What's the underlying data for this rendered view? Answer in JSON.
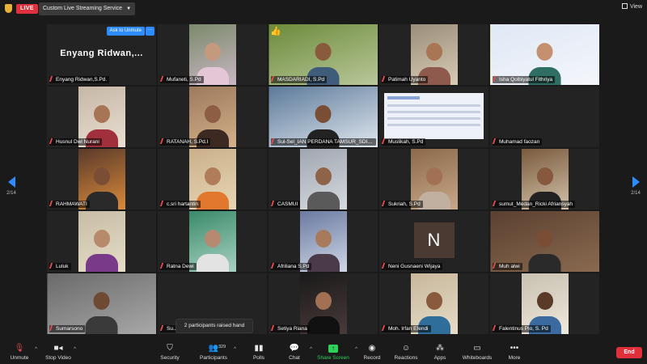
{
  "topbar": {
    "live_label": "LIVE",
    "stream_label": "Custom Live Streaming Service",
    "view_label": "View"
  },
  "pagination": {
    "left": "2/14",
    "right": "2/14"
  },
  "participants": [
    {
      "name": "Enyang Ridwan,S.Pd.",
      "display_text": "Enyang  Ridwan,...",
      "kind": "text",
      "unmute_label": "Ask to Unmute",
      "more_label": "···"
    },
    {
      "name": "Mufaneti, S.Pd",
      "kind": "video",
      "c1": "#7a8a6a",
      "c2": "#c9b6c4",
      "skin": "#c59a7c",
      "shirt": "#e3c7d6"
    },
    {
      "name": "MASDARIADI, S.Pd",
      "kind": "video",
      "wide": true,
      "c1": "#6c8a3a",
      "c2": "#b9c89a",
      "skin": "#8a5a3c",
      "shirt": "#3f5d7a",
      "hand": "👍"
    },
    {
      "name": "Patimah Uyanto",
      "kind": "video",
      "c1": "#9a8e7a",
      "c2": "#d8ccb6",
      "skin": "#a87654",
      "shirt": "#8e5a4e"
    },
    {
      "name": "Isha Qolbiyatul Fithriya",
      "kind": "video",
      "wide": true,
      "active": true,
      "c1": "#dfe8f5",
      "c2": "#f4f6fb",
      "skin": "#c49070",
      "shirt": "#2f6e62"
    },
    {
      "name": "Husnul Dwi Nurani",
      "kind": "video",
      "c1": "#c6b7a6",
      "c2": "#e9dfd2",
      "skin": "#a77456",
      "shirt": "#a0303c"
    },
    {
      "name": "RATANAH, S.Pd.I",
      "kind": "video",
      "c1": "#9c7a5c",
      "c2": "#d4b08a",
      "skin": "#8e5e44",
      "shirt": "#3c2a22"
    },
    {
      "name": "Sul-Sel_IAN PERDANA TAMSUR_SDI Ma...",
      "kind": "video",
      "wide": true,
      "c1": "#5c7a9a",
      "c2": "#dfe6ee",
      "skin": "#7a4e34",
      "shirt": "#222"
    },
    {
      "name": "Muslikah, S.Pd",
      "kind": "slide",
      "c1": "#eef2f8",
      "c2": "#eef2f8"
    },
    {
      "name": "Muhamad faozan",
      "kind": "empty"
    },
    {
      "name": "RAHMAWATI",
      "kind": "video",
      "c1": "#5a3a2a",
      "c2": "#d98a3a",
      "skin": "#7a4e34",
      "shirt": "#2a2a2a"
    },
    {
      "name": "c.sri hartantin",
      "kind": "video",
      "c1": "#c9b08a",
      "c2": "#e8d6b4",
      "skin": "#b07c5a",
      "shirt": "#e2772e"
    },
    {
      "name": "CASMUI",
      "kind": "video",
      "c1": "#a0a6b0",
      "c2": "#d6dae0",
      "skin": "#8e6448",
      "shirt": "#5a5a5a"
    },
    {
      "name": "Sukriah, S.Pd",
      "kind": "video",
      "c1": "#8a6a4a",
      "c2": "#c8a888",
      "skin": "#a27052",
      "shirt": "#c1b0a0"
    },
    {
      "name": "sumut_Medan_Ricki Afriansyah",
      "kind": "video",
      "c1": "#7a5a3e",
      "c2": "#d2c2a8",
      "skin": "#86583e",
      "shirt": "#222"
    },
    {
      "name": "Luluk",
      "kind": "video",
      "c1": "#c7bda6",
      "c2": "#e6ddc6",
      "skin": "#b68a6a",
      "shirt": "#7a3a8a"
    },
    {
      "name": "Ratna Dewi",
      "kind": "video",
      "c1": "#3a8a6a",
      "c2": "#a8d2c2",
      "skin": "#b58a70",
      "shirt": "#e3e3e3"
    },
    {
      "name": "Afriliana S.Pd",
      "kind": "video",
      "c1": "#6a7aa0",
      "c2": "#cfd6e6",
      "skin": "#a87a5c",
      "shirt": "#4a3a4a"
    },
    {
      "name": "Neni Gusnaeni Wijaya",
      "kind": "initial",
      "initial": "N"
    },
    {
      "name": "Muh alwi",
      "kind": "video",
      "wide": true,
      "c1": "#5a4030",
      "c2": "#8a6a50",
      "skin": "#7a4e34",
      "shirt": "#2a2a2a"
    },
    {
      "name": "Sumarsono",
      "kind": "video",
      "wide": true,
      "c1": "#6a6a6a",
      "c2": "#a8a8a8",
      "skin": "#6e4a34",
      "shirt": "#3a3a3a"
    },
    {
      "name": "Su...",
      "kind": "empty"
    },
    {
      "name": "Setiya Riana",
      "kind": "video",
      "c1": "#1a1a1a",
      "c2": "#4a3a3a",
      "skin": "#a27052",
      "shirt": "#111"
    },
    {
      "name": "Moh. Irfan Efendi",
      "kind": "video",
      "c1": "#c8b89c",
      "c2": "#e6dcc8",
      "skin": "#8a5a3c",
      "shirt": "#2f6e9a"
    },
    {
      "name": "Falentinus Pio, S. Pd",
      "kind": "video",
      "c1": "#c8c0b0",
      "c2": "#efe8dc",
      "skin": "#5a3a28",
      "shirt": "#3a6aa0"
    }
  ],
  "toast": "2 participants raised hand",
  "toolbar": {
    "unmute": "Unmute",
    "stop_video": "Stop Video",
    "security": "Security",
    "participants": "Participants",
    "participants_count": "329",
    "polls": "Polls",
    "chat": "Chat",
    "share_screen": "Share Screen",
    "record": "Record",
    "reactions": "Reactions",
    "apps": "Apps",
    "whiteboards": "Whiteboards",
    "more": "More",
    "end": "End"
  }
}
